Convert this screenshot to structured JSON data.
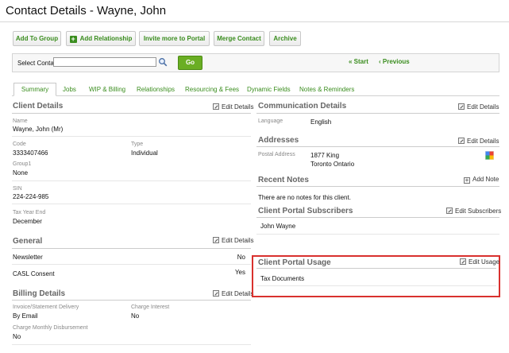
{
  "page": {
    "title": "Contact Details - Wayne, John"
  },
  "toolbar": {
    "add_to_group": "Add To Group",
    "add_relationship": "Add Relationship",
    "invite_portal": "Invite more to Portal",
    "merge_contact": "Merge Contact",
    "archive": "Archive"
  },
  "select_contact": {
    "label": "Select Contact",
    "value": "",
    "go": "Go",
    "start": "« Start",
    "previous": "‹ Previous"
  },
  "tabs": [
    "Summary",
    "Jobs",
    "WIP & Billing",
    "Relationships",
    "Resourcing & Fees",
    "Dynamic Fields",
    "Notes & Reminders"
  ],
  "client_details": {
    "title": "Client Details",
    "edit": "Edit Details",
    "name_label": "Name",
    "name": "Wayne, John (Mr)",
    "code_label": "Code",
    "code": "3333407466",
    "type_label": "Type",
    "type": "Individual",
    "group_label": "Group1",
    "group": "None",
    "sin_label": "SIN",
    "sin": "224-224-985",
    "tax_label": "Tax Year End",
    "tax": "December"
  },
  "general": {
    "title": "General",
    "edit": "Edit Details",
    "newsletter_label": "Newsletter",
    "newsletter": "No",
    "casl_label": "CASL Consent",
    "casl": "Yes"
  },
  "billing": {
    "title": "Billing Details",
    "edit": "Edit Details",
    "delivery_label": "Invoice/Statement Delivery",
    "delivery": "By Email",
    "interest_label": "Charge Interest",
    "interest": "No",
    "disbursement_label": "Charge Monthly Disbursement",
    "disbursement": "No"
  },
  "communication": {
    "title": "Communication Details",
    "edit": "Edit Details",
    "language_label": "Language",
    "language": "English"
  },
  "addresses": {
    "title": "Addresses",
    "edit": "Edit Details",
    "postal_label": "Postal Address",
    "line1": "1877 King",
    "line2": "Toronto Ontario",
    "map_icon": "map-pin-icon"
  },
  "recent_notes": {
    "title": "Recent Notes",
    "add": "Add Note",
    "empty": "There are no notes for this client."
  },
  "portal_subscribers": {
    "title": "Client Portal Subscribers",
    "edit": "Edit Subscribers",
    "subscriber": "John Wayne"
  },
  "portal_usage": {
    "title": "Client Portal Usage",
    "edit": "Edit Usage",
    "item": "Tax Documents"
  },
  "colors": {
    "accent": "#3a8d1e",
    "go_button": "#6aae23",
    "highlight": "#d9312e"
  }
}
